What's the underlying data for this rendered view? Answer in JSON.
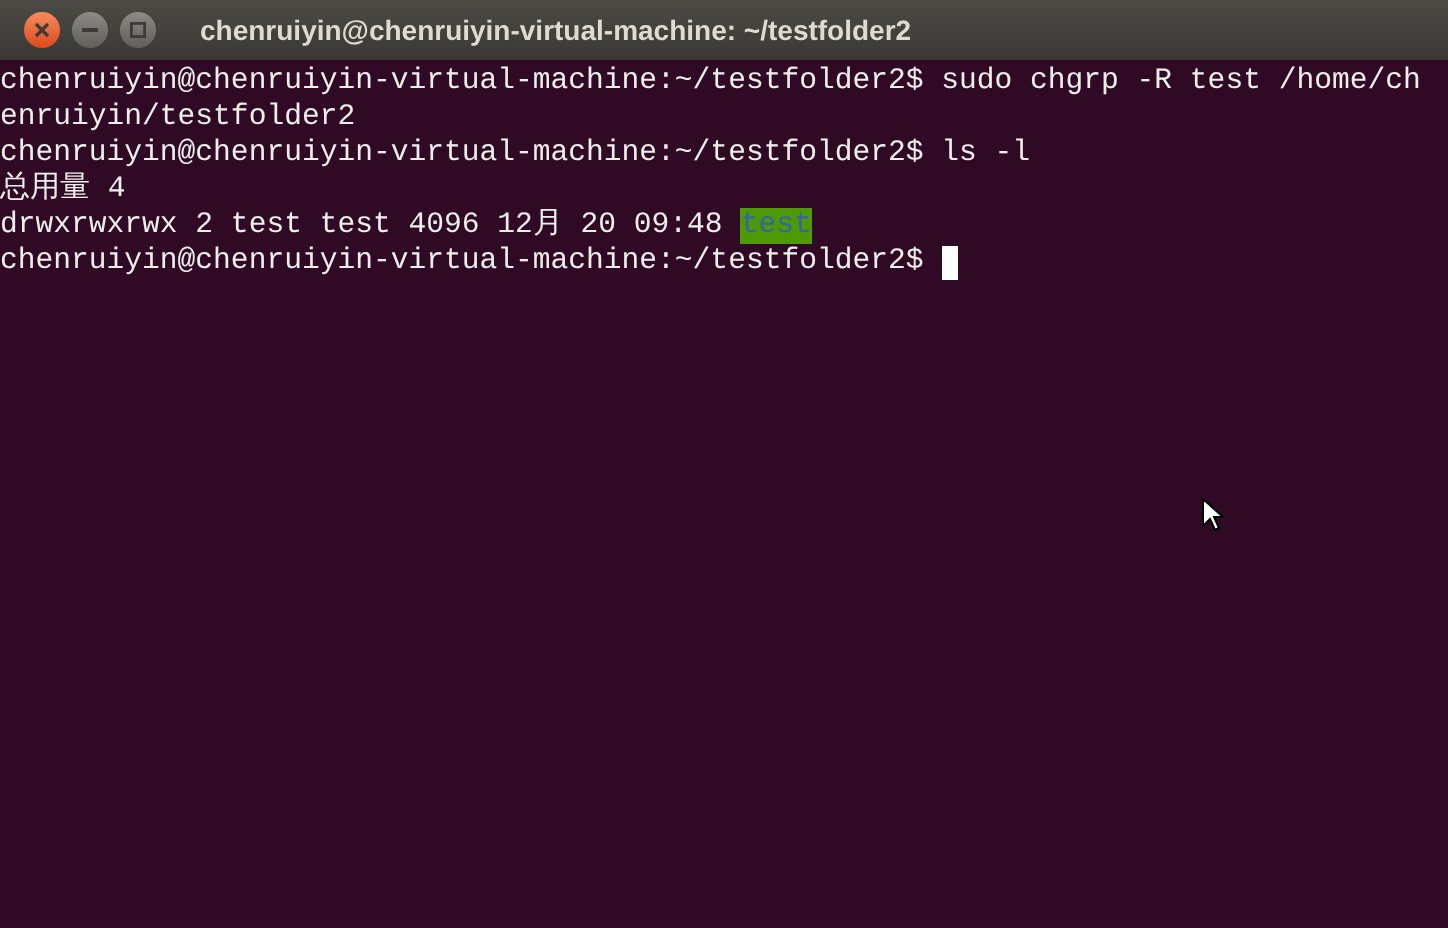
{
  "window": {
    "title": "chenruiyin@chenruiyin-virtual-machine: ~/testfolder2"
  },
  "terminal": {
    "lines": [
      {
        "kind": "text",
        "text": "chenruiyin@chenruiyin-virtual-machine:~/testfolder2$ sudo chgrp -R test /home/ch"
      },
      {
        "kind": "text",
        "text": "enruiyin/testfolder2"
      },
      {
        "kind": "text",
        "text": "chenruiyin@chenruiyin-virtual-machine:~/testfolder2$ ls -l"
      },
      {
        "kind": "text",
        "text": "总用量 4"
      },
      {
        "kind": "listing",
        "text": "drwxrwxrwx 2 test test 4096 12月 20 09:48",
        "entry": "test"
      },
      {
        "kind": "prompt",
        "text": "chenruiyin@chenruiyin-virtual-machine:~/testfolder2$",
        "cursor": true
      }
    ]
  }
}
